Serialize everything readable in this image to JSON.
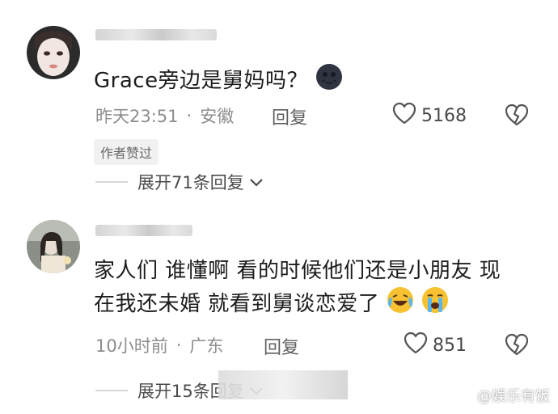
{
  "comments": [
    {
      "text": "Grace旁边是舅妈吗？",
      "emoji": "new-moon-face",
      "time": "昨天23:51",
      "location": "安徽",
      "reply_label": "回复",
      "likes": "5168",
      "badge": "作者赞过",
      "expand_label": "展开71条回复"
    },
    {
      "text_line1": "家人们 谁懂啊 看的时候他们还是小朋友 现",
      "text_line2": "在我还未婚 就看到舅谈恋爱了",
      "emojis": [
        "laughing-crying-face",
        "crying-face"
      ],
      "time": "10小时前",
      "location": "广东",
      "reply_label": "回复",
      "likes": "851",
      "expand_label": "展开15条回复"
    }
  ],
  "separator": "·",
  "watermark": {
    "icon": "weibo-logo-icon",
    "text": "@娱乐有饭"
  }
}
